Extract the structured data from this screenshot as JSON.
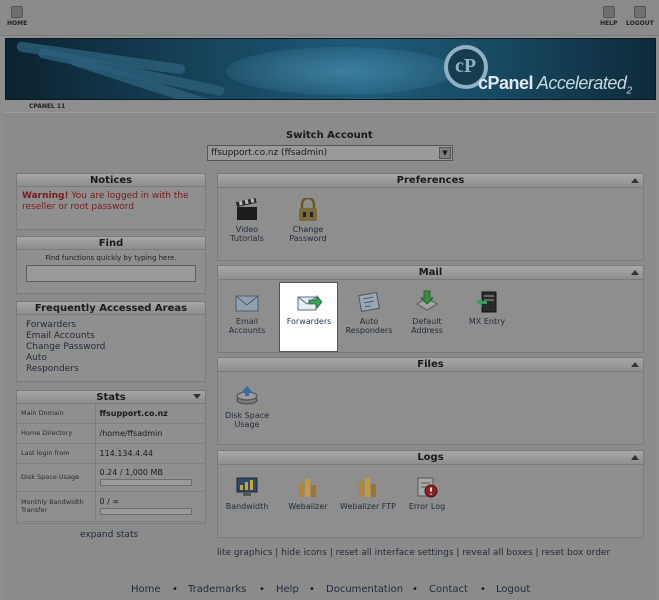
{
  "topbar": {
    "home": "HOME",
    "help": "HELP",
    "logout": "LOGOUT"
  },
  "banner": {
    "brand": "cPanel",
    "brand_suffix": "Accelerated",
    "brand_version": "2"
  },
  "breadcrumb": "CPANEL 11",
  "switch_account": {
    "title": "Switch Account",
    "selected": "ffsupport.co.nz (ffsadmin)"
  },
  "notices": {
    "title": "Notices",
    "warning_label": "Warning!",
    "warning_text": " You are logged in with the reseller or root password"
  },
  "find": {
    "title": "Find",
    "hint": "Find functions quickly by typing here."
  },
  "faa": {
    "title": "Frequently Accessed Areas",
    "items": [
      "Forwarders",
      "Email Accounts",
      "Change Password",
      "Auto",
      "Responders"
    ]
  },
  "stats": {
    "title": "Stats",
    "rows": [
      {
        "label": "Main Domain",
        "value": "ffsupport.co.nz"
      },
      {
        "label": "Home Directory",
        "value": "/home/ffsadmin"
      },
      {
        "label": "Last login from",
        "value": "114.134.4.44"
      },
      {
        "label": "Disk Space Usage",
        "value": "0.24 / 1,000 MB",
        "fill": 0.0
      },
      {
        "label": "Monthly Bandwidth Transfer",
        "value": "0 / ∞",
        "fill": 0.0
      }
    ],
    "expand": "expand stats"
  },
  "preferences": {
    "title": "Preferences",
    "items": [
      {
        "label": "Video Tutorials",
        "icon": "clapperboard-icon"
      },
      {
        "label": "Change Password",
        "icon": "padlock-icon"
      }
    ]
  },
  "mail": {
    "title": "Mail",
    "items": [
      {
        "label": "Email Accounts",
        "icon": "envelope-icon"
      },
      {
        "label": "Forwarders",
        "icon": "forward-envelope-icon"
      },
      {
        "label": "Auto Responders",
        "icon": "auto-responder-icon"
      },
      {
        "label": "Default Address",
        "icon": "default-address-icon"
      },
      {
        "label": "MX Entry",
        "icon": "mx-entry-icon"
      }
    ]
  },
  "files": {
    "title": "Files",
    "items": [
      {
        "label": "Disk Space Usage",
        "icon": "disk-usage-icon"
      }
    ]
  },
  "logs": {
    "title": "Logs",
    "items": [
      {
        "label": "Bandwidth",
        "icon": "bandwidth-icon"
      },
      {
        "label": "Webalizer",
        "icon": "webalizer-icon"
      },
      {
        "label": "Webalizer FTP",
        "icon": "webalizer-ftp-icon"
      },
      {
        "label": "Error Log",
        "icon": "error-log-icon"
      }
    ]
  },
  "footer_links": "lite graphics | hide icons | reset all interface settings | reveal all boxes | reset box order",
  "bottom_nav": [
    "Home",
    "Trademarks",
    "Help",
    "Documentation",
    "Contact",
    "Logout"
  ]
}
